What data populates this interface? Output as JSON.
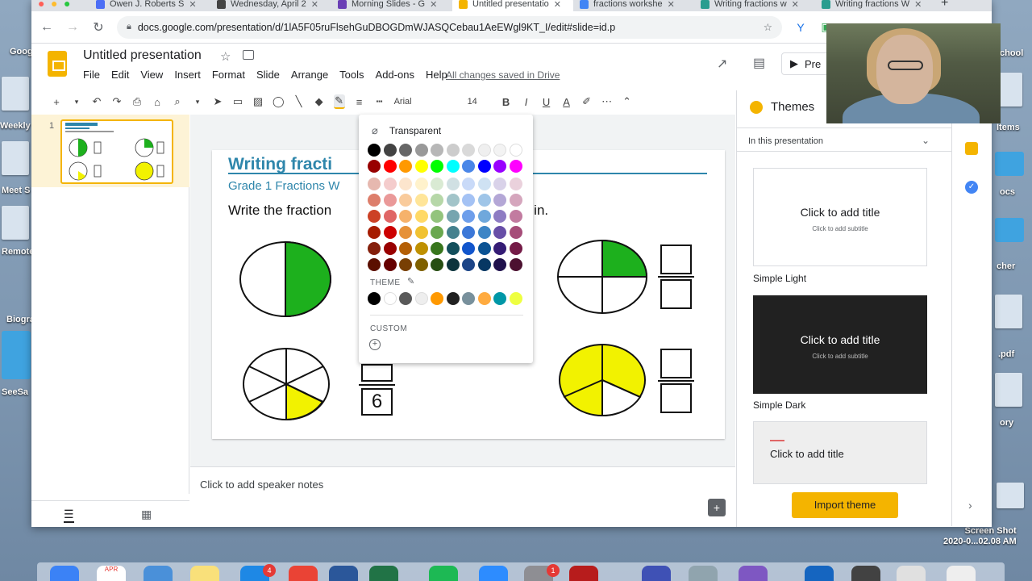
{
  "browser": {
    "tabs": [
      {
        "label": "Owen J. Roberts S",
        "icon_color": "#4c6ef5"
      },
      {
        "label": "Wednesday, April 2",
        "icon_color": "#444444"
      },
      {
        "label": "Morning Slides - G",
        "icon_color": "#6a3fb5"
      },
      {
        "label": "Untitled presentatio",
        "icon_color": "#f4b400",
        "active": true
      },
      {
        "label": "fractions workshe",
        "icon_color": "#4285f4"
      },
      {
        "label": "Writing fractions w",
        "icon_color": "#2a9d8f"
      },
      {
        "label": "Writing fractions W",
        "icon_color": "#2a9d8f"
      }
    ],
    "new_tab": "+",
    "url": "docs.google.com/presentation/d/1lA5F05ruFlsehGuDBOGDmWJASQCebau1AeEWgl9KT_I/edit#slide=id.p"
  },
  "header": {
    "title": "Untitled presentation",
    "menu": [
      "File",
      "Edit",
      "View",
      "Insert",
      "Format",
      "Slide",
      "Arrange",
      "Tools",
      "Add-ons",
      "Help"
    ],
    "saved_status": "All changes saved in Drive",
    "present_label": "Pre"
  },
  "toolbar": {
    "font": "Arial",
    "size": "14"
  },
  "filmstrip": {
    "slide_number": "1"
  },
  "slide": {
    "title": "Writing fracti",
    "subtitle": "Grade 1 Fractions W",
    "instruction_left": "Write the fraction",
    "instruction_right": "d in.",
    "denominator": "6"
  },
  "notes": {
    "placeholder": "Click to add speaker notes"
  },
  "picker": {
    "transparent_label": "Transparent",
    "theme_label": "THEME",
    "custom_label": "CUSTOM",
    "grid": [
      [
        "#000000",
        "#434343",
        "#666666",
        "#999999",
        "#b7b7b7",
        "#cccccc",
        "#d9d9d9",
        "#efefef",
        "#f3f3f3",
        "#ffffff"
      ],
      [
        "#980000",
        "#ff0000",
        "#ff9900",
        "#ffff00",
        "#00ff00",
        "#00ffff",
        "#4a86e8",
        "#0000ff",
        "#9900ff",
        "#ff00ff"
      ],
      [
        "#e6b8af",
        "#f4cccc",
        "#fce5cd",
        "#fff2cc",
        "#d9ead3",
        "#d0e0e3",
        "#c9daf8",
        "#cfe2f3",
        "#d9d2e9",
        "#ead1dc"
      ],
      [
        "#dd7e6b",
        "#ea9999",
        "#f9cb9c",
        "#ffe599",
        "#b6d7a8",
        "#a2c4c9",
        "#a4c2f4",
        "#9fc5e8",
        "#b4a7d6",
        "#d5a6bd"
      ],
      [
        "#cc4125",
        "#e06666",
        "#f6b26b",
        "#ffd966",
        "#93c47d",
        "#76a5af",
        "#6d9eeb",
        "#6fa8dc",
        "#8e7cc3",
        "#c27ba0"
      ],
      [
        "#a61c00",
        "#cc0000",
        "#e69138",
        "#f1c232",
        "#6aa84f",
        "#45818e",
        "#3c78d8",
        "#3d85c6",
        "#674ea7",
        "#a64d79"
      ],
      [
        "#85200c",
        "#990000",
        "#b45f06",
        "#bf9000",
        "#38761d",
        "#134f5c",
        "#1155cc",
        "#0b5394",
        "#351c75",
        "#741b47"
      ],
      [
        "#5b0f00",
        "#660000",
        "#783f04",
        "#7f6000",
        "#274e13",
        "#0c343d",
        "#1c4587",
        "#073763",
        "#20124d",
        "#4c1130"
      ]
    ],
    "theme_colors": [
      "#000000",
      "#ffffff",
      "#595959",
      "#eeeeee",
      "#ff9900",
      "#212121",
      "#78909c",
      "#ffab40",
      "#0097a7",
      "#eeff41"
    ]
  },
  "themes": {
    "heading": "Themes",
    "section": "In this presentation",
    "cards": [
      {
        "name": "Simple Light",
        "title": "Click to add title",
        "subtitle": "Click to add subtitle",
        "bg": "#ffffff",
        "fg": "#202124"
      },
      {
        "name": "Simple Dark",
        "title": "Click to add title",
        "subtitle": "Click to add subtitle",
        "bg": "#212121",
        "fg": "#ffffff"
      },
      {
        "name": "",
        "title": "Click to add title",
        "subtitle": "",
        "bg": "#eeeeee",
        "fg": "#202124"
      }
    ],
    "import_label": "Import theme"
  },
  "desktop": {
    "labels": [
      "Goog",
      "Weekly",
      "Meet S",
      "Remote",
      "Biogra",
      "SeeSa",
      "chool",
      "Items",
      "ocs",
      "cher",
      ".pdf",
      "ory"
    ],
    "screenshot_label": "Screen Shot\n2020-0...02.08 AM"
  },
  "dock": {
    "calendar_month": "APR",
    "badges": [
      "4",
      "1"
    ]
  },
  "colors": {
    "accent": "#f4b400",
    "slide_blue": "#2e86ab",
    "fraction_green": "#1db01d",
    "fraction_yellow": "#f2f200"
  }
}
